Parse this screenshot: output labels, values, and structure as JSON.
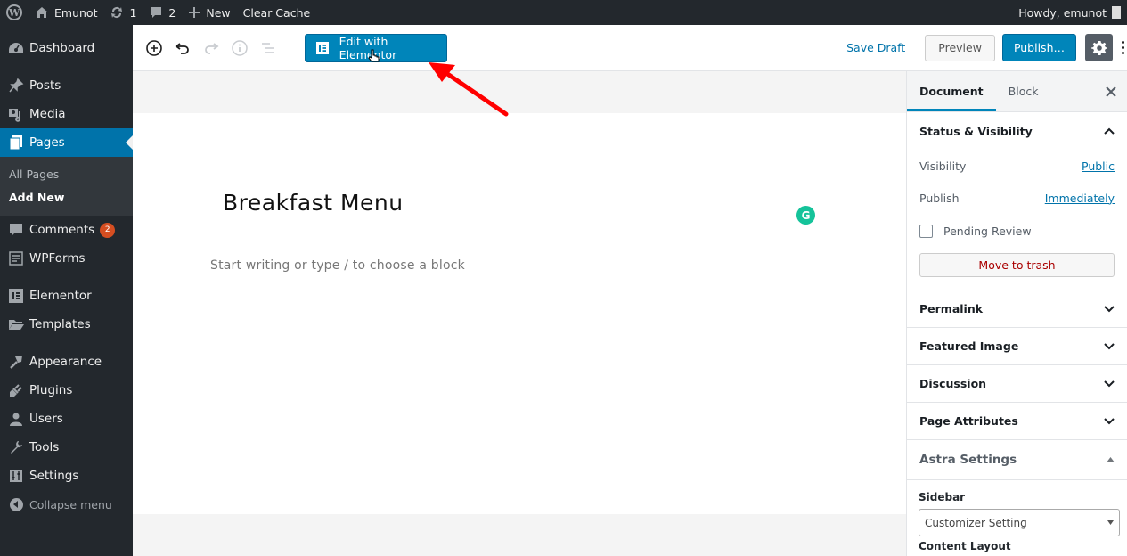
{
  "admin_bar": {
    "site_name": "Emunot",
    "updates_count": "1",
    "comments_count": "2",
    "new_label": "New",
    "clear_cache_label": "Clear Cache",
    "greeting": "Howdy, emunot"
  },
  "sidebar": {
    "items": [
      {
        "label": "Dashboard",
        "icon": "dashboard-icon"
      },
      {
        "label": "Posts",
        "icon": "pin-icon"
      },
      {
        "label": "Media",
        "icon": "media-icon"
      },
      {
        "label": "Pages",
        "icon": "pages-icon",
        "active": true
      },
      {
        "label": "Comments",
        "icon": "comment-icon",
        "badge": "2"
      },
      {
        "label": "WPForms",
        "icon": "forms-icon"
      },
      {
        "label": "Elementor",
        "icon": "elementor-icon"
      },
      {
        "label": "Templates",
        "icon": "folder-icon"
      },
      {
        "label": "Appearance",
        "icon": "brush-icon"
      },
      {
        "label": "Plugins",
        "icon": "plug-icon"
      },
      {
        "label": "Users",
        "icon": "user-icon"
      },
      {
        "label": "Tools",
        "icon": "wrench-icon"
      },
      {
        "label": "Settings",
        "icon": "settings-sliders-icon"
      }
    ],
    "submenu": [
      {
        "label": "All Pages"
      },
      {
        "label": "Add New",
        "current": true
      }
    ],
    "collapse_label": "Collapse menu"
  },
  "toolbar": {
    "edit_elementor_label": "Edit with Elementor",
    "save_draft_label": "Save Draft",
    "preview_label": "Preview",
    "publish_label": "Publish…"
  },
  "editor": {
    "title": "Breakfast Menu",
    "placeholder": "Start writing or type / to choose a block",
    "grammarly_letter": "G"
  },
  "settings_panel": {
    "tabs": [
      {
        "label": "Document",
        "active": true
      },
      {
        "label": "Block"
      }
    ],
    "status_visibility": {
      "title": "Status & Visibility",
      "visibility_label": "Visibility",
      "visibility_value": "Public",
      "publish_label": "Publish",
      "publish_value": "Immediately",
      "pending_review_label": "Pending Review",
      "pending_review_checked": false,
      "trash_label": "Move to trash"
    },
    "collapsed_panels": [
      {
        "title": "Permalink"
      },
      {
        "title": "Featured Image"
      },
      {
        "title": "Discussion"
      },
      {
        "title": "Page Attributes"
      }
    ],
    "astra": {
      "title": "Astra Settings",
      "sidebar_label": "Sidebar",
      "sidebar_value": "Customizer Setting",
      "content_layout_label": "Content Layout"
    }
  },
  "colors": {
    "accent": "#0085ba",
    "admin_dark": "#23282d",
    "badge": "#d54e21",
    "annotation_arrow": "#ff0000",
    "grammarly": "#15c39a",
    "trash": "#aa0000"
  }
}
